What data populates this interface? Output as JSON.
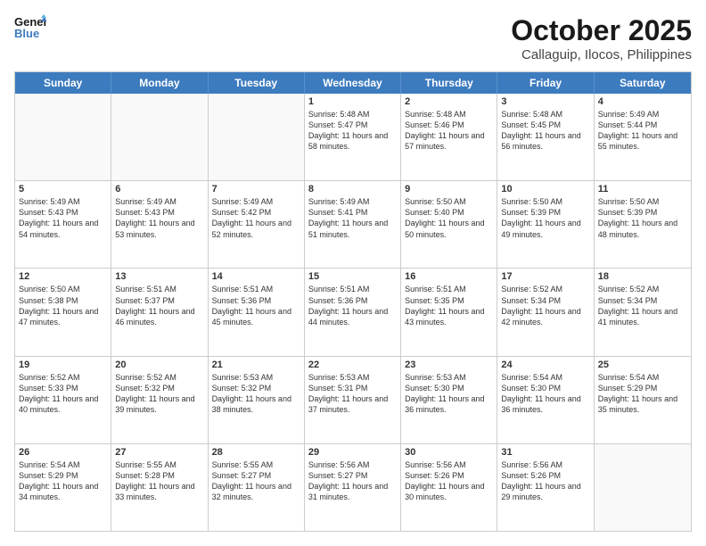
{
  "header": {
    "logo_general": "General",
    "logo_blue": "Blue",
    "month": "October 2025",
    "location": "Callaguip, Ilocos, Philippines"
  },
  "days": [
    "Sunday",
    "Monday",
    "Tuesday",
    "Wednesday",
    "Thursday",
    "Friday",
    "Saturday"
  ],
  "weeks": [
    [
      {
        "num": "",
        "empty": true
      },
      {
        "num": "",
        "empty": true
      },
      {
        "num": "",
        "empty": true
      },
      {
        "num": "1",
        "sunrise": "Sunrise: 5:48 AM",
        "sunset": "Sunset: 5:47 PM",
        "daylight": "Daylight: 11 hours and 58 minutes."
      },
      {
        "num": "2",
        "sunrise": "Sunrise: 5:48 AM",
        "sunset": "Sunset: 5:46 PM",
        "daylight": "Daylight: 11 hours and 57 minutes."
      },
      {
        "num": "3",
        "sunrise": "Sunrise: 5:48 AM",
        "sunset": "Sunset: 5:45 PM",
        "daylight": "Daylight: 11 hours and 56 minutes."
      },
      {
        "num": "4",
        "sunrise": "Sunrise: 5:49 AM",
        "sunset": "Sunset: 5:44 PM",
        "daylight": "Daylight: 11 hours and 55 minutes."
      }
    ],
    [
      {
        "num": "5",
        "sunrise": "Sunrise: 5:49 AM",
        "sunset": "Sunset: 5:43 PM",
        "daylight": "Daylight: 11 hours and 54 minutes."
      },
      {
        "num": "6",
        "sunrise": "Sunrise: 5:49 AM",
        "sunset": "Sunset: 5:43 PM",
        "daylight": "Daylight: 11 hours and 53 minutes."
      },
      {
        "num": "7",
        "sunrise": "Sunrise: 5:49 AM",
        "sunset": "Sunset: 5:42 PM",
        "daylight": "Daylight: 11 hours and 52 minutes."
      },
      {
        "num": "8",
        "sunrise": "Sunrise: 5:49 AM",
        "sunset": "Sunset: 5:41 PM",
        "daylight": "Daylight: 11 hours and 51 minutes."
      },
      {
        "num": "9",
        "sunrise": "Sunrise: 5:50 AM",
        "sunset": "Sunset: 5:40 PM",
        "daylight": "Daylight: 11 hours and 50 minutes."
      },
      {
        "num": "10",
        "sunrise": "Sunrise: 5:50 AM",
        "sunset": "Sunset: 5:39 PM",
        "daylight": "Daylight: 11 hours and 49 minutes."
      },
      {
        "num": "11",
        "sunrise": "Sunrise: 5:50 AM",
        "sunset": "Sunset: 5:39 PM",
        "daylight": "Daylight: 11 hours and 48 minutes."
      }
    ],
    [
      {
        "num": "12",
        "sunrise": "Sunrise: 5:50 AM",
        "sunset": "Sunset: 5:38 PM",
        "daylight": "Daylight: 11 hours and 47 minutes."
      },
      {
        "num": "13",
        "sunrise": "Sunrise: 5:51 AM",
        "sunset": "Sunset: 5:37 PM",
        "daylight": "Daylight: 11 hours and 46 minutes."
      },
      {
        "num": "14",
        "sunrise": "Sunrise: 5:51 AM",
        "sunset": "Sunset: 5:36 PM",
        "daylight": "Daylight: 11 hours and 45 minutes."
      },
      {
        "num": "15",
        "sunrise": "Sunrise: 5:51 AM",
        "sunset": "Sunset: 5:36 PM",
        "daylight": "Daylight: 11 hours and 44 minutes."
      },
      {
        "num": "16",
        "sunrise": "Sunrise: 5:51 AM",
        "sunset": "Sunset: 5:35 PM",
        "daylight": "Daylight: 11 hours and 43 minutes."
      },
      {
        "num": "17",
        "sunrise": "Sunrise: 5:52 AM",
        "sunset": "Sunset: 5:34 PM",
        "daylight": "Daylight: 11 hours and 42 minutes."
      },
      {
        "num": "18",
        "sunrise": "Sunrise: 5:52 AM",
        "sunset": "Sunset: 5:34 PM",
        "daylight": "Daylight: 11 hours and 41 minutes."
      }
    ],
    [
      {
        "num": "19",
        "sunrise": "Sunrise: 5:52 AM",
        "sunset": "Sunset: 5:33 PM",
        "daylight": "Daylight: 11 hours and 40 minutes."
      },
      {
        "num": "20",
        "sunrise": "Sunrise: 5:52 AM",
        "sunset": "Sunset: 5:32 PM",
        "daylight": "Daylight: 11 hours and 39 minutes."
      },
      {
        "num": "21",
        "sunrise": "Sunrise: 5:53 AM",
        "sunset": "Sunset: 5:32 PM",
        "daylight": "Daylight: 11 hours and 38 minutes."
      },
      {
        "num": "22",
        "sunrise": "Sunrise: 5:53 AM",
        "sunset": "Sunset: 5:31 PM",
        "daylight": "Daylight: 11 hours and 37 minutes."
      },
      {
        "num": "23",
        "sunrise": "Sunrise: 5:53 AM",
        "sunset": "Sunset: 5:30 PM",
        "daylight": "Daylight: 11 hours and 36 minutes."
      },
      {
        "num": "24",
        "sunrise": "Sunrise: 5:54 AM",
        "sunset": "Sunset: 5:30 PM",
        "daylight": "Daylight: 11 hours and 36 minutes."
      },
      {
        "num": "25",
        "sunrise": "Sunrise: 5:54 AM",
        "sunset": "Sunset: 5:29 PM",
        "daylight": "Daylight: 11 hours and 35 minutes."
      }
    ],
    [
      {
        "num": "26",
        "sunrise": "Sunrise: 5:54 AM",
        "sunset": "Sunset: 5:29 PM",
        "daylight": "Daylight: 11 hours and 34 minutes."
      },
      {
        "num": "27",
        "sunrise": "Sunrise: 5:55 AM",
        "sunset": "Sunset: 5:28 PM",
        "daylight": "Daylight: 11 hours and 33 minutes."
      },
      {
        "num": "28",
        "sunrise": "Sunrise: 5:55 AM",
        "sunset": "Sunset: 5:27 PM",
        "daylight": "Daylight: 11 hours and 32 minutes."
      },
      {
        "num": "29",
        "sunrise": "Sunrise: 5:56 AM",
        "sunset": "Sunset: 5:27 PM",
        "daylight": "Daylight: 11 hours and 31 minutes."
      },
      {
        "num": "30",
        "sunrise": "Sunrise: 5:56 AM",
        "sunset": "Sunset: 5:26 PM",
        "daylight": "Daylight: 11 hours and 30 minutes."
      },
      {
        "num": "31",
        "sunrise": "Sunrise: 5:56 AM",
        "sunset": "Sunset: 5:26 PM",
        "daylight": "Daylight: 11 hours and 29 minutes."
      },
      {
        "num": "",
        "empty": true
      }
    ]
  ]
}
